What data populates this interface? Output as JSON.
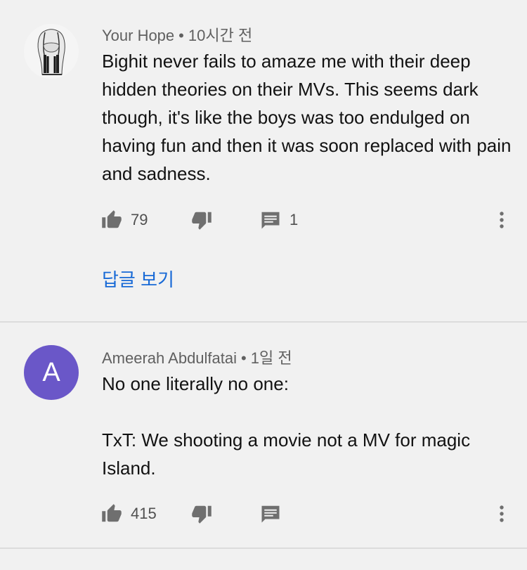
{
  "comments": [
    {
      "author": "Your Hope",
      "separator": "•",
      "time": "10시간 전",
      "text": "Bighit never fails to amaze me with their deep hidden theories on their MVs. This seems dark though, it's like the boys was too endulged on having fun and then it was soon replaced with pain and sadness.",
      "likes": "79",
      "replies_count": "1",
      "view_replies": "답글 보기"
    },
    {
      "author": "Ameerah Abdulfatai",
      "separator": "•",
      "time": "1일 전",
      "avatar_letter": "A",
      "avatar_color": "#6a57c8",
      "text": "No one literally no one:\n\nTxT: We shooting a movie not a MV for magic Island.",
      "likes": "415"
    }
  ],
  "colors": {
    "background": "#f1f1f1",
    "link": "#1769d6",
    "icon": "#6f6f6f"
  },
  "icons": [
    "thumb-up-icon",
    "thumb-down-icon",
    "reply-icon",
    "more-vert-icon"
  ]
}
